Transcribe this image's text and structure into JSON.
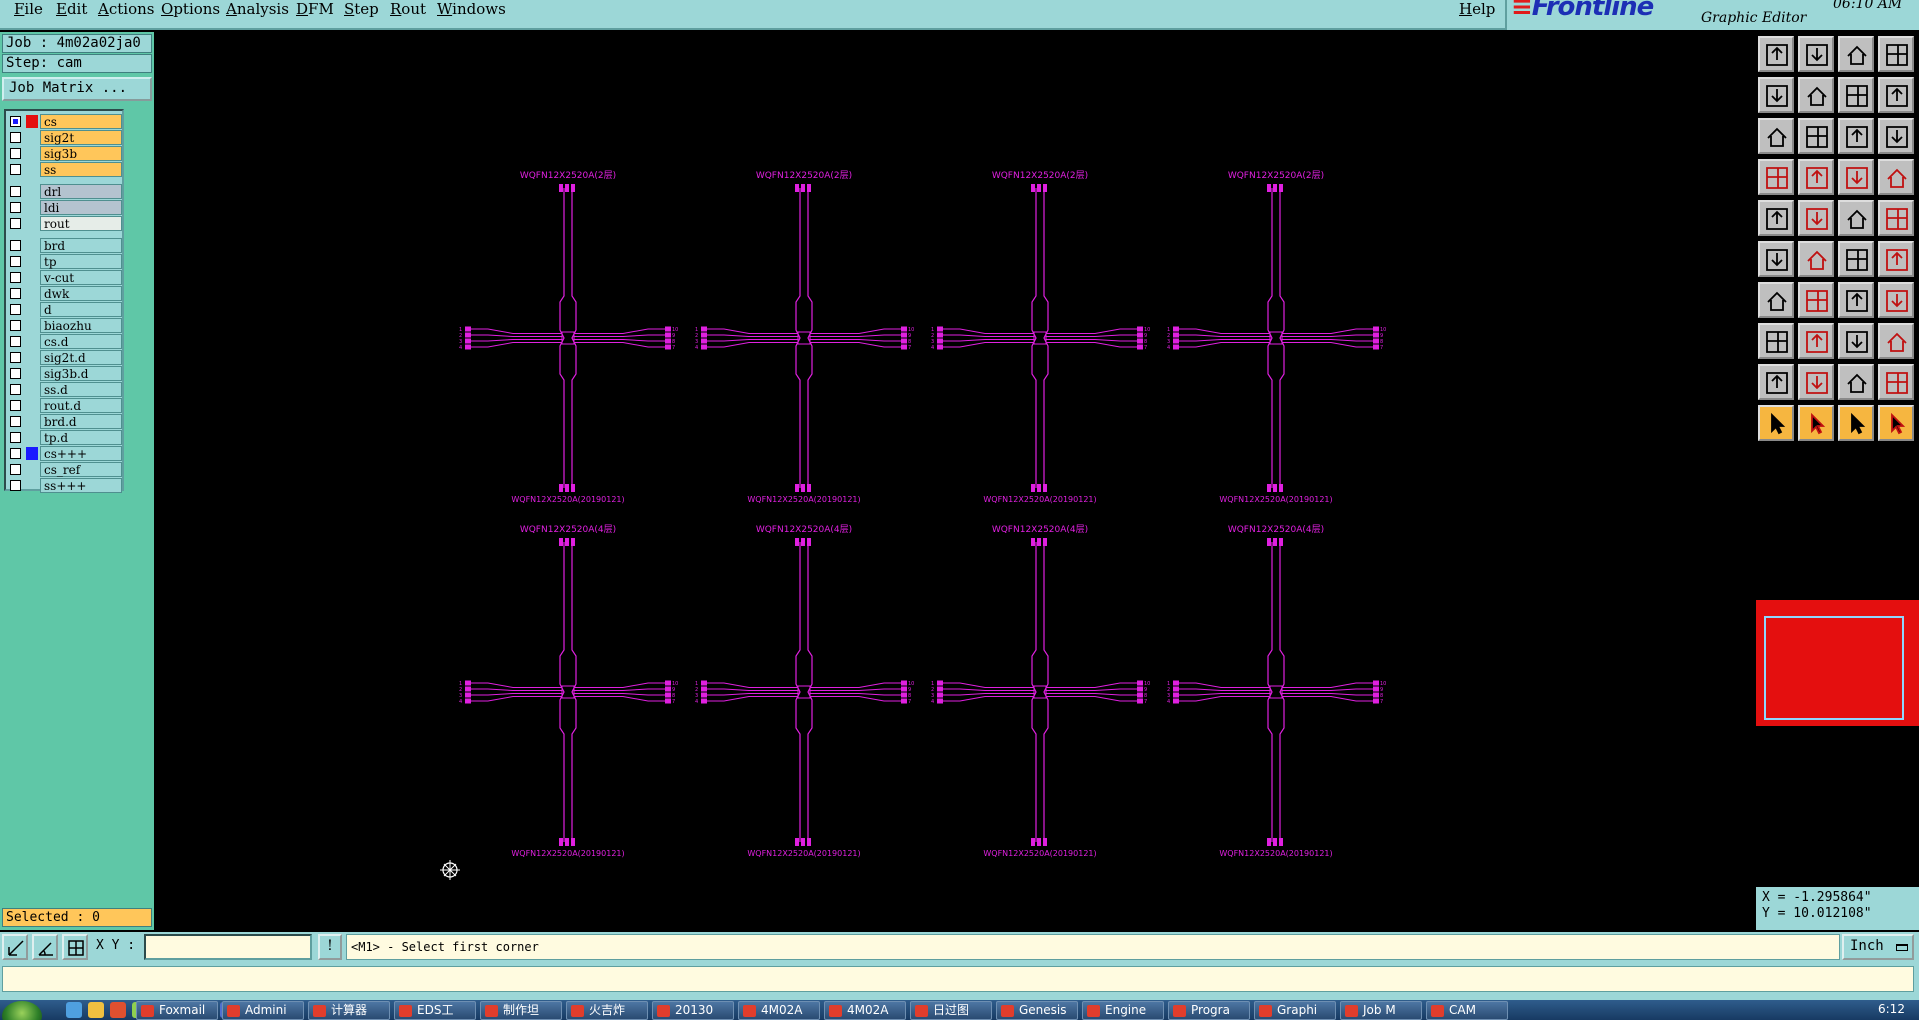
{
  "menubar": {
    "items": [
      "File",
      "Edit",
      "Actions",
      "Options",
      "Analysis",
      "DFM",
      "Step",
      "Rout",
      "Windows"
    ],
    "help": "Help"
  },
  "brand": {
    "logo": "Frontline",
    "subtitle": "Graphic Editor",
    "clock": "06:10 AM"
  },
  "left": {
    "job": "Job : 4m02a02ja0",
    "step": "Step: cam",
    "job_matrix": "Job Matrix ...",
    "selected": "Selected : 0"
  },
  "layers": [
    {
      "name": "cs",
      "kind": "board",
      "checked": true,
      "swatch": "#e40f0f"
    },
    {
      "name": "sig2t",
      "kind": "board",
      "checked": false,
      "swatch": ""
    },
    {
      "name": "sig3b",
      "kind": "board",
      "checked": false,
      "swatch": ""
    },
    {
      "name": "ss",
      "kind": "board",
      "checked": false,
      "swatch": ""
    },
    {
      "name": "drl",
      "kind": "drill",
      "checked": false,
      "swatch": ""
    },
    {
      "name": "ldi",
      "kind": "drill",
      "checked": false,
      "swatch": ""
    },
    {
      "name": "rout",
      "kind": "rout",
      "checked": false,
      "swatch": ""
    },
    {
      "name": "brd",
      "kind": "misc",
      "checked": false,
      "swatch": ""
    },
    {
      "name": "tp",
      "kind": "misc",
      "checked": false,
      "swatch": ""
    },
    {
      "name": "v-cut",
      "kind": "misc",
      "checked": false,
      "swatch": ""
    },
    {
      "name": "dwk",
      "kind": "misc",
      "checked": false,
      "swatch": ""
    },
    {
      "name": "d",
      "kind": "misc",
      "checked": false,
      "swatch": ""
    },
    {
      "name": "biaozhu",
      "kind": "misc",
      "checked": false,
      "swatch": ""
    },
    {
      "name": "cs.d",
      "kind": "misc",
      "checked": false,
      "swatch": ""
    },
    {
      "name": "sig2t.d",
      "kind": "misc",
      "checked": false,
      "swatch": ""
    },
    {
      "name": "sig3b.d",
      "kind": "misc",
      "checked": false,
      "swatch": ""
    },
    {
      "name": "ss.d",
      "kind": "misc",
      "checked": false,
      "swatch": ""
    },
    {
      "name": "rout.d",
      "kind": "misc",
      "checked": false,
      "swatch": ""
    },
    {
      "name": "brd.d",
      "kind": "misc",
      "checked": false,
      "swatch": ""
    },
    {
      "name": "tp.d",
      "kind": "misc",
      "checked": false,
      "swatch": ""
    },
    {
      "name": "cs+++",
      "kind": "misc",
      "checked": false,
      "swatch": "#1a1aff"
    },
    {
      "name": "cs_ref",
      "kind": "misc",
      "checked": false,
      "swatch": ""
    },
    {
      "name": "ss+++",
      "kind": "misc",
      "checked": false,
      "swatch": ""
    }
  ],
  "canvas": {
    "trace_color": "#e020e0",
    "top_label_row1": "WQFN12X2520A(2层)",
    "bottom_label_row1": "WQFN12X2520A(20190121)",
    "top_label_row2": "WQFN12X2520A(4层)",
    "bottom_label_row2": "WQFN12X2520A(20190121)",
    "pin_left": [
      "1",
      "2",
      "3",
      "4"
    ],
    "pin_right": [
      "10",
      "9",
      "8",
      "7"
    ]
  },
  "coords": {
    "x": "X = -1.295864\"",
    "y": "Y = 10.012108\""
  },
  "status": {
    "xy_label": "X Y :",
    "xy_value": "",
    "info": "!",
    "prompt": "<M1> - Select first corner",
    "unit": "Inch"
  },
  "taskbar": {
    "tasks": [
      "Foxmail",
      "Admini",
      "计算器",
      "EDS工",
      "制作坦",
      "火吉炸",
      "20130",
      "4M02A",
      "4M02A",
      "日过图",
      "Genesis",
      "Engine",
      "Progra",
      "Graphi",
      "Job M",
      "CAM"
    ],
    "clock": "6:12"
  },
  "colors": {
    "panel": "#9cd7d7",
    "panel_side": "#5fc7a7",
    "highlight": "#ffc65a",
    "overview": "#e40f0f"
  }
}
